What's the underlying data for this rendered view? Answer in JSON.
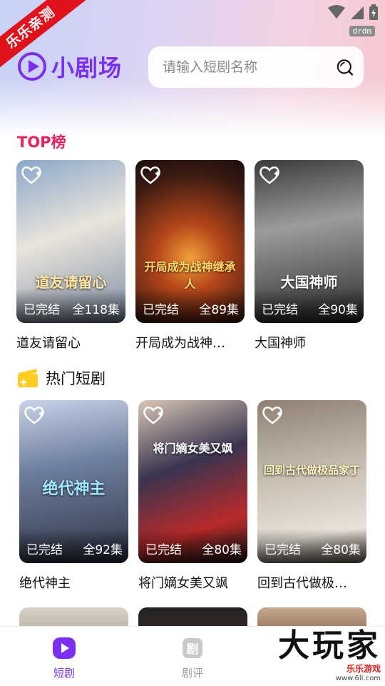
{
  "ribbon": "乐乐亲测",
  "status_badge": "drdm",
  "app": {
    "name": "小剧场"
  },
  "search": {
    "placeholder": "请输入短剧名称"
  },
  "sections": {
    "top": "TOP榜",
    "hot": "热门短剧"
  },
  "top_list": [
    {
      "title": "道友请留心",
      "status": "已完结",
      "episodes": "全118集",
      "caption": "道友请留心"
    },
    {
      "title": "开局成为战神…",
      "status": "已完结",
      "episodes": "全89集",
      "caption": "开局成为战神继承人"
    },
    {
      "title": "大国神师",
      "status": "已完结",
      "episodes": "全90集",
      "caption": "大国神师"
    }
  ],
  "hot_list": [
    {
      "title": "绝代神主",
      "status": "已完结",
      "episodes": "全92集",
      "caption": "绝代神主"
    },
    {
      "title": "将门嫡女美又飒",
      "status": "已完结",
      "episodes": "全80集",
      "caption": "将门嫡女美又飒"
    },
    {
      "title": "回到古代做极…",
      "status": "已完结",
      "episodes": "全80集",
      "caption": "回到古代做极品家丁"
    }
  ],
  "bottom_nav": [
    {
      "label": "短剧",
      "icon": "play-icon",
      "active": true
    },
    {
      "label": "剧评",
      "icon": "review-icon",
      "active": false
    }
  ],
  "watermark": {
    "main": "大玩家",
    "sub": "乐乐游戏",
    "url": "www.6ll.com"
  },
  "colors": {
    "brand": "#7b2ff0",
    "top_title": "#e8225c",
    "ribbon": "#e0121b"
  }
}
